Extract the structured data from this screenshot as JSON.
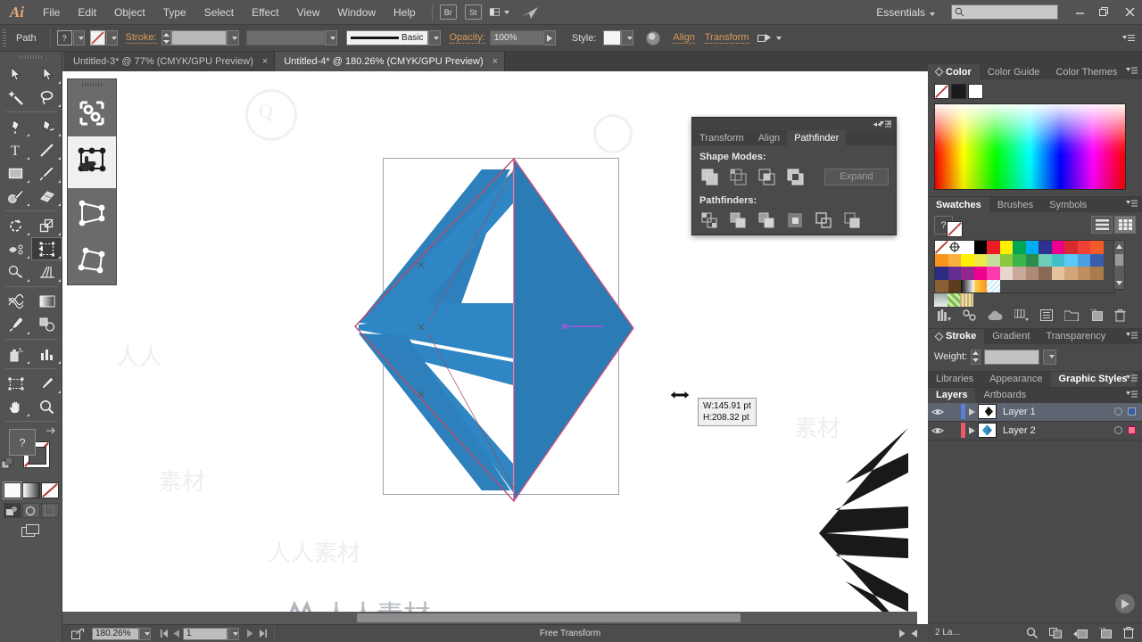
{
  "app": {
    "name": "Adobe Illustrator",
    "logo_text": "Ai",
    "workspace": "Essentials"
  },
  "menubar": {
    "items": [
      "File",
      "Edit",
      "Object",
      "Type",
      "Select",
      "Effect",
      "View",
      "Window",
      "Help"
    ],
    "bridge_button": "Br",
    "stock_button": "St",
    "arrange_documents": "arrange-documents-icon",
    "search_placeholder": "",
    "window_controls": [
      "minimize",
      "restore",
      "close"
    ]
  },
  "controlbar": {
    "object_type": "Path",
    "fill_label": "?",
    "stroke_label": "Stroke:",
    "stroke_weight": "",
    "stroke_profile": "",
    "brush_definition": "Basic",
    "opacity_label": "Opacity:",
    "opacity_value": "100%",
    "style_label": "Style:",
    "align_label": "Align",
    "transform_label": "Transform",
    "recolor_artwork": "recolor-artwork-icon"
  },
  "tabs": [
    {
      "title": "Untitled-3* @ 77% (CMYK/GPU Preview)",
      "active": false,
      "close": "×"
    },
    {
      "title": "Untitled-4* @ 180.26% (CMYK/GPU Preview)",
      "active": true,
      "close": "×"
    }
  ],
  "toolbar": {
    "tools": [
      {
        "name": "selection-tool",
        "selected": false
      },
      {
        "name": "direct-selection-tool",
        "selected": false
      },
      {
        "name": "magic-wand-tool",
        "selected": false
      },
      {
        "name": "lasso-tool",
        "selected": false
      },
      {
        "name": "pen-tool",
        "selected": false
      },
      {
        "name": "curvature-tool",
        "selected": false
      },
      {
        "name": "type-tool",
        "selected": false
      },
      {
        "name": "line-segment-tool",
        "selected": false
      },
      {
        "name": "rectangle-tool",
        "selected": false
      },
      {
        "name": "paintbrush-tool",
        "selected": false
      },
      {
        "name": "shaper-tool",
        "selected": false
      },
      {
        "name": "eraser-tool",
        "selected": false
      },
      {
        "name": "rotate-tool",
        "selected": false
      },
      {
        "name": "scale-tool",
        "selected": false
      },
      {
        "name": "width-tool",
        "selected": false
      },
      {
        "name": "free-transform-tool",
        "selected": true
      },
      {
        "name": "shape-builder-tool",
        "selected": false
      },
      {
        "name": "perspective-grid-tool",
        "selected": false
      },
      {
        "name": "mesh-tool",
        "selected": false
      },
      {
        "name": "gradient-tool",
        "selected": false
      },
      {
        "name": "eyedropper-tool",
        "selected": false
      },
      {
        "name": "blend-tool",
        "selected": false
      },
      {
        "name": "symbol-sprayer-tool",
        "selected": false
      },
      {
        "name": "column-graph-tool",
        "selected": false
      },
      {
        "name": "artboard-tool",
        "selected": false
      },
      {
        "name": "slice-tool",
        "selected": false
      },
      {
        "name": "hand-tool",
        "selected": false
      },
      {
        "name": "zoom-tool",
        "selected": false
      }
    ],
    "fill_swatch": "?",
    "stroke_swatch": "none",
    "color_modes": [
      "color",
      "gradient",
      "none"
    ],
    "draw_modes": [
      "draw-normal",
      "draw-behind",
      "draw-inside"
    ],
    "screen_mode": "screen-mode-icon"
  },
  "free_transform_widget": {
    "items": [
      {
        "name": "constrain-toggle",
        "selected": false
      },
      {
        "name": "free-transform",
        "selected": true
      },
      {
        "name": "perspective-distort",
        "selected": false
      },
      {
        "name": "free-distort",
        "selected": false
      }
    ]
  },
  "pathfinder_panel": {
    "tabs": [
      "Transform",
      "Align",
      "Pathfinder"
    ],
    "active_tab": "Pathfinder",
    "shape_modes_label": "Shape Modes:",
    "shape_modes": [
      "unite",
      "minus-front",
      "intersect",
      "exclude"
    ],
    "expand_button": "Expand",
    "pathfinders_label": "Pathfinders:",
    "pathfinders": [
      "divide",
      "trim",
      "merge",
      "crop",
      "outline",
      "minus-back"
    ],
    "collapse_icon": "◂◂",
    "close_icon": "×"
  },
  "canvas": {
    "tooltip": {
      "width_text": "W:145.91 pt",
      "height_text": "H:208.32 pt"
    },
    "artwork_fill": "#2b7fb8",
    "artwork_fill_light": "#3a93cc",
    "artwork_stroke": "#d94f7a",
    "second_artwork_fill": "#1a1a1a",
    "watermark_text": "人人素材",
    "selection_handle": "transform-handle"
  },
  "statusbar": {
    "zoom_level": "180.26%",
    "artboard_number": "1",
    "tool_status": "Free Transform"
  },
  "color_panel": {
    "tabs": [
      "Color",
      "Color Guide",
      "Color Themes"
    ],
    "active_tab": "Color",
    "chips": [
      "none",
      "black",
      "white"
    ]
  },
  "swatches_panel": {
    "tabs": [
      "Swatches",
      "Brushes",
      "Symbols"
    ],
    "active_tab": "Swatches",
    "colors": [
      "#ffffff",
      "#000000",
      "#ed1c24",
      "#fff200",
      "#00a651",
      "#00aeef",
      "#2e3192",
      "#ec008c",
      "#cc2229",
      "#ef4136",
      "#f15a29",
      "#f7941e",
      "#fbb040",
      "#fdc689",
      "#fff200",
      "#eeea48",
      "#c4df9b",
      "#8dc63f",
      "#39b54a",
      "#2b8c4b",
      "#6dcdb8",
      "#3fc0c9",
      "#5bc8f5",
      "#4a9fe0",
      "#3b5bab",
      "#2b2d82",
      "#662d91",
      "#92278f",
      "#bd2f8e",
      "#ec008c",
      "#ff6ec7",
      "#e8d6cc",
      "#c9a899",
      "#b08a78",
      "#8a6a56",
      "#e5c29f",
      "#d2a679",
      "#c08f5e",
      "#a97c4a",
      "#8a5f33",
      "#6b4423",
      "#4a2e17",
      "#ffffff",
      "#ffd24a",
      "#a8dcf0"
    ],
    "footer_icons": [
      "swatch-libraries",
      "show-swatch-kinds",
      "cloud",
      "color-group",
      "swatch-options",
      "new-color-group",
      "new-swatch",
      "delete-swatch"
    ]
  },
  "stroke_panel": {
    "tabs": [
      "Stroke",
      "Gradient",
      "Transparency"
    ],
    "active_tab": "Stroke",
    "weight_label": "Weight:",
    "weight_value": ""
  },
  "appearance_panel": {
    "tabs": [
      "Libraries",
      "Appearance",
      "Graphic Styles"
    ],
    "active_tab": "Graphic Styles"
  },
  "layers_panel": {
    "tabs": [
      "Layers",
      "Artboards"
    ],
    "active_tab": "Layers",
    "rows": [
      {
        "name": "Layer 1",
        "visible": true,
        "selected": true,
        "color": "#5a7fd4",
        "target_color": "#3b5bab",
        "thumb": "layer1-thumb"
      },
      {
        "name": "Layer 2",
        "visible": true,
        "selected": false,
        "color": "#e85b6a",
        "target_color": "#f07a86",
        "thumb": "layer2-thumb"
      }
    ],
    "footer_count": "2 La...",
    "footer_icons": [
      "locate-object",
      "make-clipping-mask",
      "create-new-sublayer",
      "create-new-layer",
      "delete-selection"
    ]
  }
}
